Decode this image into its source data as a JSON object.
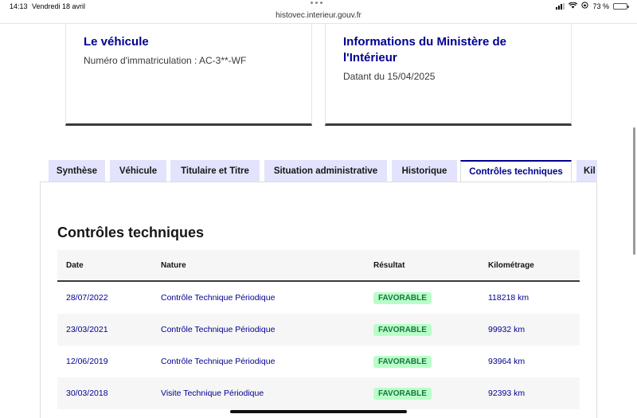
{
  "statusbar": {
    "time": "14:13",
    "date": "Vendredi 18 avril",
    "url": "histovec.interieur.gouv.fr",
    "battery": "73 %",
    "battery_level": 0.73
  },
  "cards": {
    "vehicle": {
      "title": "Le véhicule",
      "text": "Numéro d'immatriculation : AC-3**-WF"
    },
    "ministry": {
      "title": "Informations du Ministère de l'Intérieur",
      "text": "Datant du 15/04/2025"
    }
  },
  "tabs": [
    {
      "label": "Synthèse"
    },
    {
      "label": "Véhicule"
    },
    {
      "label": "Titulaire et Titre"
    },
    {
      "label": "Situation administrative"
    },
    {
      "label": "Historique"
    },
    {
      "label": "Contrôles techniques",
      "active": true
    },
    {
      "label": "Kil"
    }
  ],
  "section": {
    "title": "Contrôles techniques"
  },
  "table": {
    "headers": {
      "date": "Date",
      "nature": "Nature",
      "result": "Résultat",
      "km": "Kilométrage"
    },
    "rows": [
      {
        "date": "28/07/2022",
        "nature": "Contrôle Technique Périodique",
        "result": "FAVORABLE",
        "km": "118218 km"
      },
      {
        "date": "23/03/2021",
        "nature": "Contrôle Technique Périodique",
        "result": "FAVORABLE",
        "km": "99932 km"
      },
      {
        "date": "12/06/2019",
        "nature": "Contrôle Technique Périodique",
        "result": "FAVORABLE",
        "km": "93964 km"
      },
      {
        "date": "30/03/2018",
        "nature": "Visite Technique Périodique",
        "result": "FAVORABLE",
        "km": "92393 km"
      }
    ]
  },
  "colors": {
    "accent": "#000091",
    "tab_bg": "#e3e3fd",
    "badge_bg": "#b8fec9",
    "badge_text": "#18753c"
  }
}
